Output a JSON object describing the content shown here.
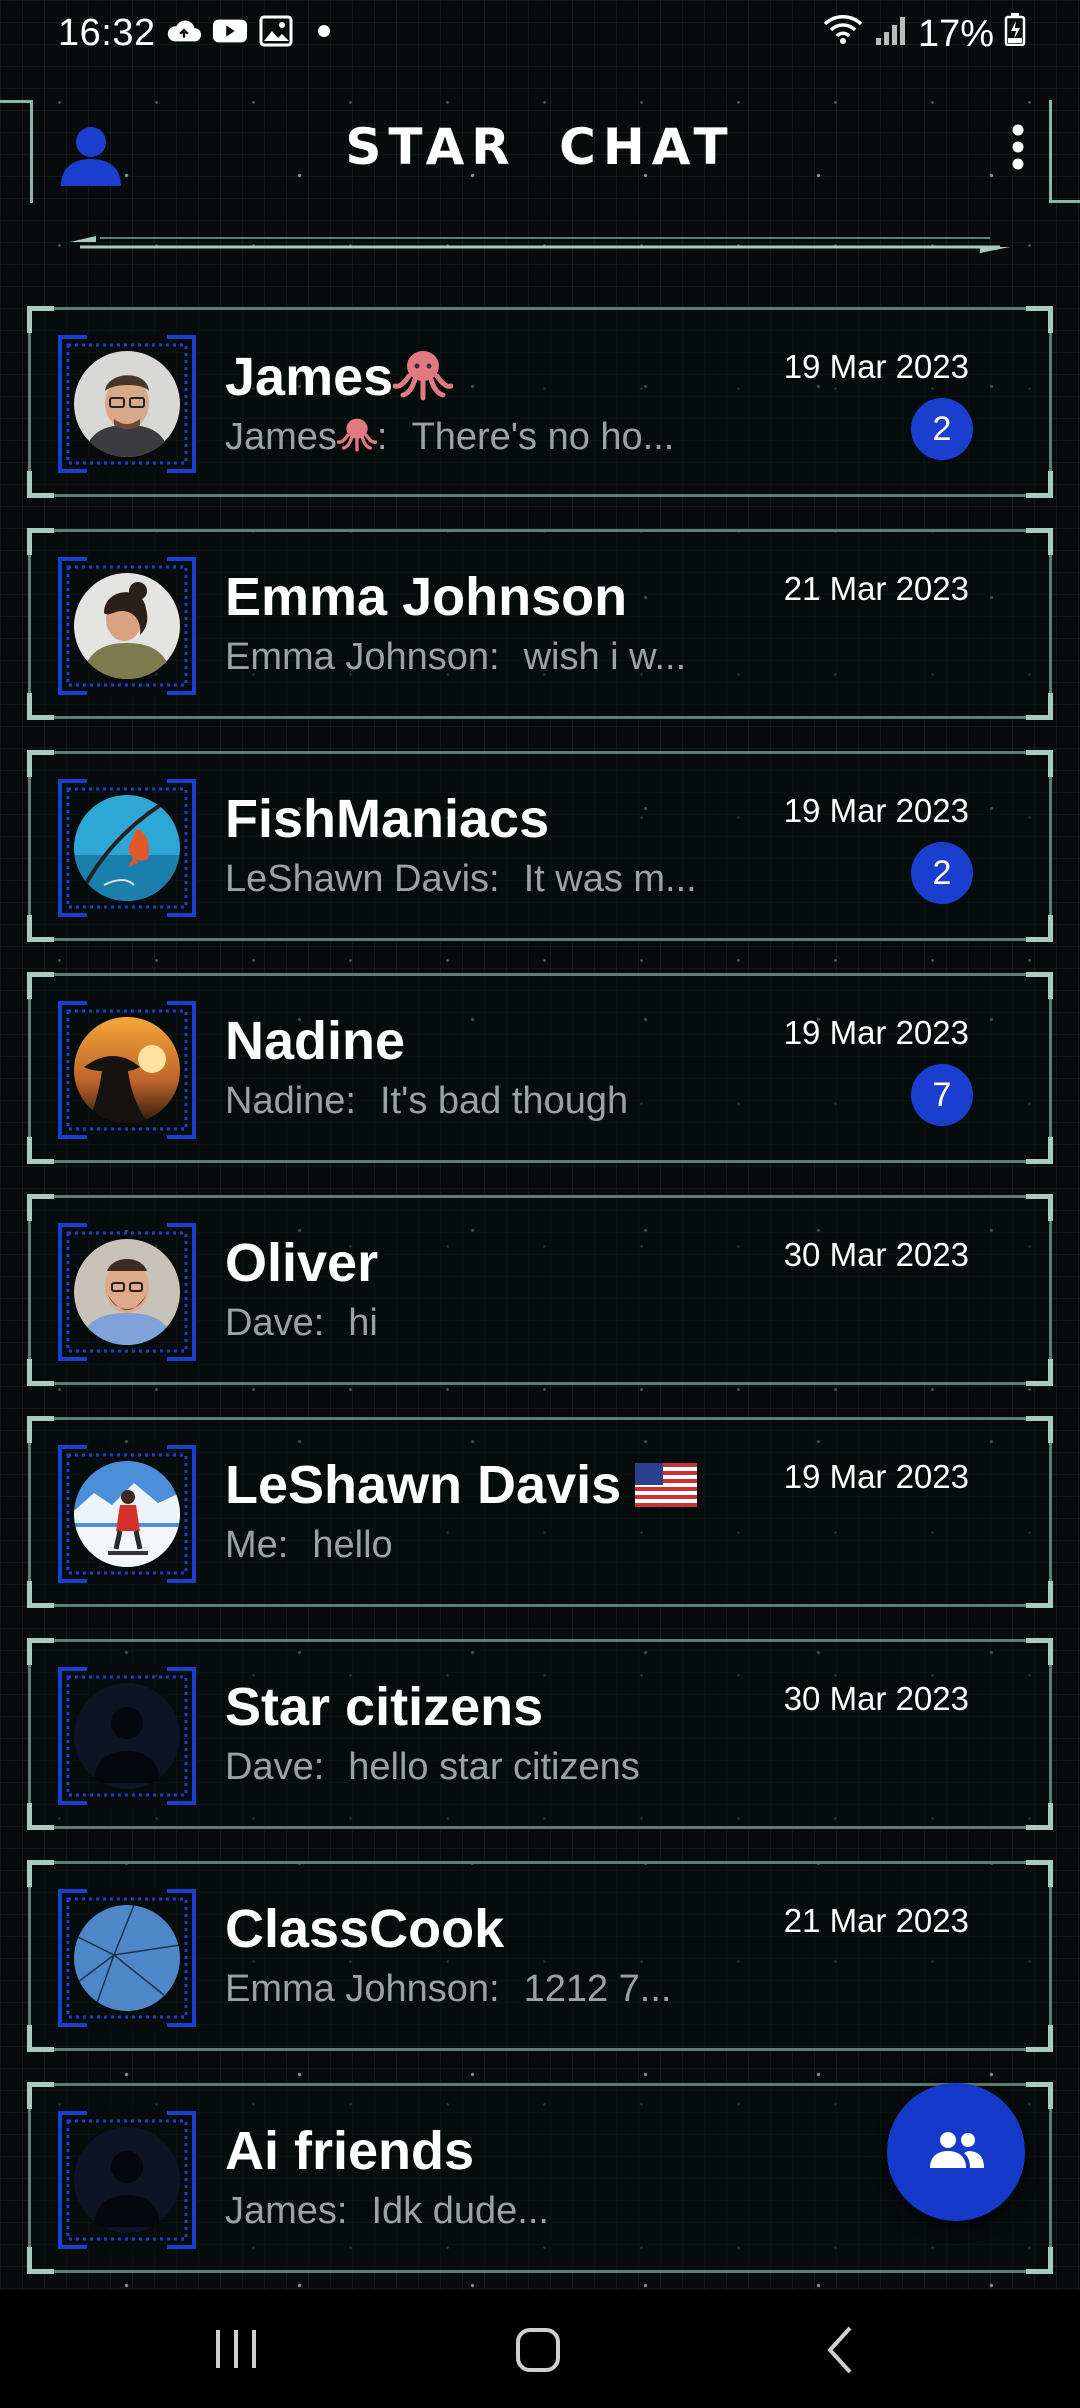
{
  "status_bar": {
    "time": "16:32",
    "battery": "17%"
  },
  "header": {
    "title": "STAR   CHAT"
  },
  "colors": {
    "accent": "#1a3fcf",
    "card_border": "#5f7d72",
    "card_corner": "#a9cbbd"
  },
  "chats": [
    {
      "name": "James",
      "name_suffix": "octopus-emoji",
      "sender": "James",
      "sender_suffix": "octopus-emoji",
      "preview": "There's no ho...",
      "date": "19 Mar 2023",
      "unread": "2",
      "avatar": "avatar-man-glasses"
    },
    {
      "name": "Emma Johnson",
      "sender": "Emma Johnson:",
      "preview": "wish i w...",
      "date": "21 Mar 2023",
      "unread": "",
      "avatar": "avatar-woman"
    },
    {
      "name": "FishManiacs",
      "sender": "LeShawn Davis:",
      "preview": "It was m...",
      "date": "19 Mar 2023",
      "unread": "2",
      "avatar": "avatar-fishing"
    },
    {
      "name": "Nadine",
      "sender": "Nadine:",
      "preview": "It's bad though",
      "date": "19 Mar 2023",
      "unread": "7",
      "avatar": "avatar-sunset"
    },
    {
      "name": "Oliver",
      "sender": "Dave:",
      "preview": "hi",
      "date": "30 Mar 2023",
      "unread": "",
      "avatar": "avatar-man-beard"
    },
    {
      "name": "LeShawn Davis",
      "name_suffix": "us-flag-emoji",
      "sender": "Me:",
      "preview": "hello",
      "date": "19 Mar 2023",
      "unread": "",
      "avatar": "avatar-snow"
    },
    {
      "name": "Star citizens",
      "sender": "Dave:",
      "preview": "hello star citizens",
      "date": "30 Mar 2023",
      "unread": "",
      "avatar": "avatar-placeholder"
    },
    {
      "name": "ClassCook",
      "sender": "Emma Johnson:",
      "preview": "1212 7...",
      "date": "21 Mar 2023",
      "unread": "",
      "avatar": "avatar-cracked-glass"
    },
    {
      "name": "Ai friends",
      "sender": "James:",
      "preview": "Idk dude...",
      "date": "",
      "unread": "",
      "avatar": "avatar-placeholder"
    }
  ],
  "fab": {
    "icon": "group-icon"
  },
  "nav": {
    "recent": "recent-apps-icon",
    "home": "home-icon",
    "back": "back-icon"
  }
}
